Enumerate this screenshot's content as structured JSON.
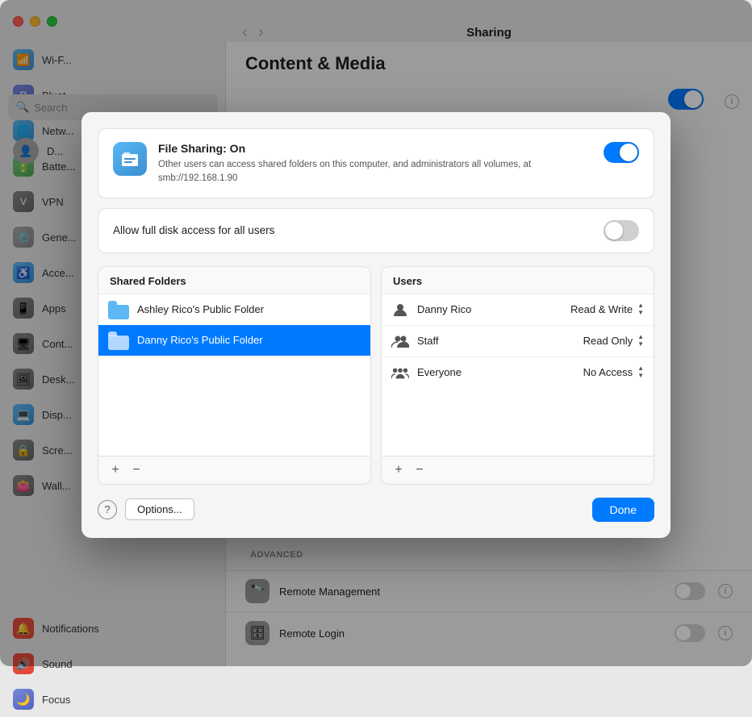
{
  "window": {
    "title": "Sharing",
    "traffic_lights": [
      "close",
      "minimize",
      "maximize"
    ]
  },
  "background": {
    "nav_title": "Sharing",
    "back_btn": "‹",
    "fwd_btn": "›",
    "section_content_media": "Content & Media",
    "section_advanced": "Advanced",
    "remote_management_label": "Remote Management",
    "remote_login_label": "Remote Login",
    "search_placeholder": "Search",
    "sidebar_items": [
      {
        "label": "D...",
        "icon_color": "#888",
        "type": "top"
      },
      {
        "label": "Wi-F...",
        "icon": "wifi-icon",
        "color": "wifi"
      },
      {
        "label": "Bluet...",
        "icon": "bluetooth-icon",
        "color": "bluetooth"
      },
      {
        "label": "Netw...",
        "icon": "network-icon",
        "color": "network"
      },
      {
        "label": "Batte...",
        "icon": "battery-icon",
        "color": "battery"
      },
      {
        "label": "VPN",
        "icon": "vpn-icon",
        "color": "vpn"
      },
      {
        "label": "Gene...",
        "icon": "general-icon",
        "color": "general"
      },
      {
        "label": "Acce...",
        "icon": "accessibility-icon",
        "color": "accessibility"
      },
      {
        "label": "Apps",
        "icon": "apps-icon",
        "color": "apps"
      },
      {
        "label": "Cont...",
        "icon": "control-icon",
        "color": "control"
      },
      {
        "label": "Desk...",
        "icon": "desktop-icon",
        "color": "desktop"
      },
      {
        "label": "Disp...",
        "icon": "display-icon",
        "color": "display"
      },
      {
        "label": "Scre...",
        "icon": "screen-icon",
        "color": "screen"
      },
      {
        "label": "Wall...",
        "icon": "wallet-icon",
        "color": "wallet"
      },
      {
        "label": "Notifications",
        "icon": "notifications-icon",
        "color": "notifications"
      },
      {
        "label": "Sound",
        "icon": "sound-icon",
        "color": "sound"
      },
      {
        "label": "Focus",
        "icon": "focus-icon",
        "color": "focus"
      }
    ]
  },
  "modal": {
    "file_sharing": {
      "title": "File Sharing: On",
      "description": "Other users can access shared folders on this computer, and administrators all volumes, at smb://192.168.1.90",
      "toggle_state": "on"
    },
    "full_disk_access": {
      "label": "Allow full disk access for all users",
      "toggle_state": "off"
    },
    "shared_folders": {
      "header": "Shared Folders",
      "items": [
        {
          "label": "Ashley Rico's Public Folder",
          "selected": false
        },
        {
          "label": "Danny Rico's Public Folder",
          "selected": true
        }
      ],
      "add_btn": "+",
      "remove_btn": "−"
    },
    "users": {
      "header": "Users",
      "items": [
        {
          "name": "Danny Rico",
          "permission": "Read & Write",
          "icon_type": "single"
        },
        {
          "name": "Staff",
          "permission": "Read Only",
          "icon_type": "double"
        },
        {
          "name": "Everyone",
          "permission": "No Access",
          "icon_type": "triple"
        }
      ],
      "add_btn": "+",
      "remove_btn": "−"
    },
    "footer": {
      "help_label": "?",
      "options_label": "Options...",
      "done_label": "Done"
    }
  }
}
